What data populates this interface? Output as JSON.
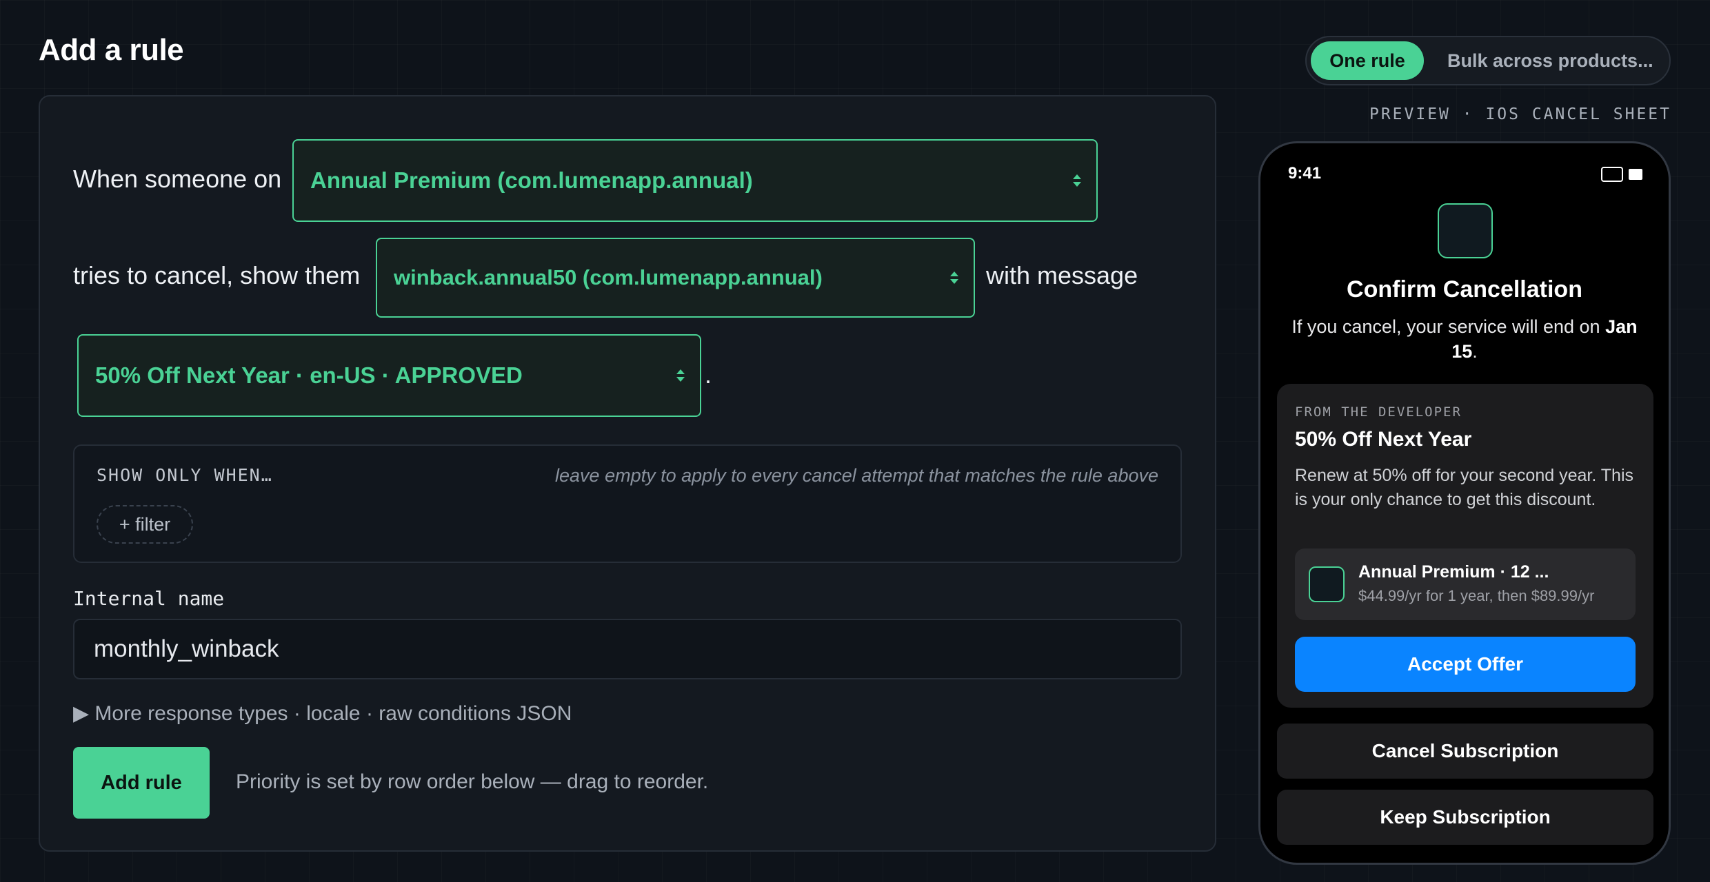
{
  "page": {
    "title": "Add a rule"
  },
  "rule": {
    "when_text": "When someone on",
    "product_select": "Annual Premium (com.lumenapp.annual)",
    "show_text": "tries to cancel, show them",
    "offer_select": "winback.annual50 (com.lumenapp.annual)",
    "message_text": "with message",
    "message_select": "50% Off Next Year · en-US · APPROVED",
    "period": "."
  },
  "filters": {
    "heading": "SHOW ONLY WHEN…",
    "hint": "leave empty to apply to every cancel attempt that matches the rule above",
    "add_label": "+ filter"
  },
  "internal_name": {
    "label": "Internal name",
    "value": "monthly_winback"
  },
  "more_options": {
    "arrow": "▶",
    "label": "More response types · locale · raw conditions JSON"
  },
  "actions": {
    "add_rule": "Add rule",
    "priority_note": "Priority is set by row order below — drag to reorder."
  },
  "mode_toggle": {
    "selected": "One rule",
    "other": "Bulk across products..."
  },
  "preview": {
    "label": "PREVIEW · IOS CANCEL SHEET",
    "status_time": "9:41",
    "sheet_title": "Confirm Cancellation",
    "sheet_sub_prefix": "If you cancel, your service will end on",
    "sheet_sub_date": "Jan 15",
    "sheet_sub_suffix": ".",
    "developer_label": "FROM THE DEVELOPER",
    "offer_title": "50% Off Next Year",
    "offer_body": "Renew at 50% off for your second year. This is your only chance to get this discount.",
    "product_name": "Annual Premium · 12 ...",
    "product_price": "$44.99/yr for 1 year, then $89.99/yr",
    "accept_button": "Accept Offer",
    "cancel_button": "Cancel Subscription",
    "keep_button": "Keep Subscription"
  },
  "colors": {
    "accent": "#4ad295",
    "ios_blue": "#0a84ff",
    "background": "#0e131a"
  }
}
